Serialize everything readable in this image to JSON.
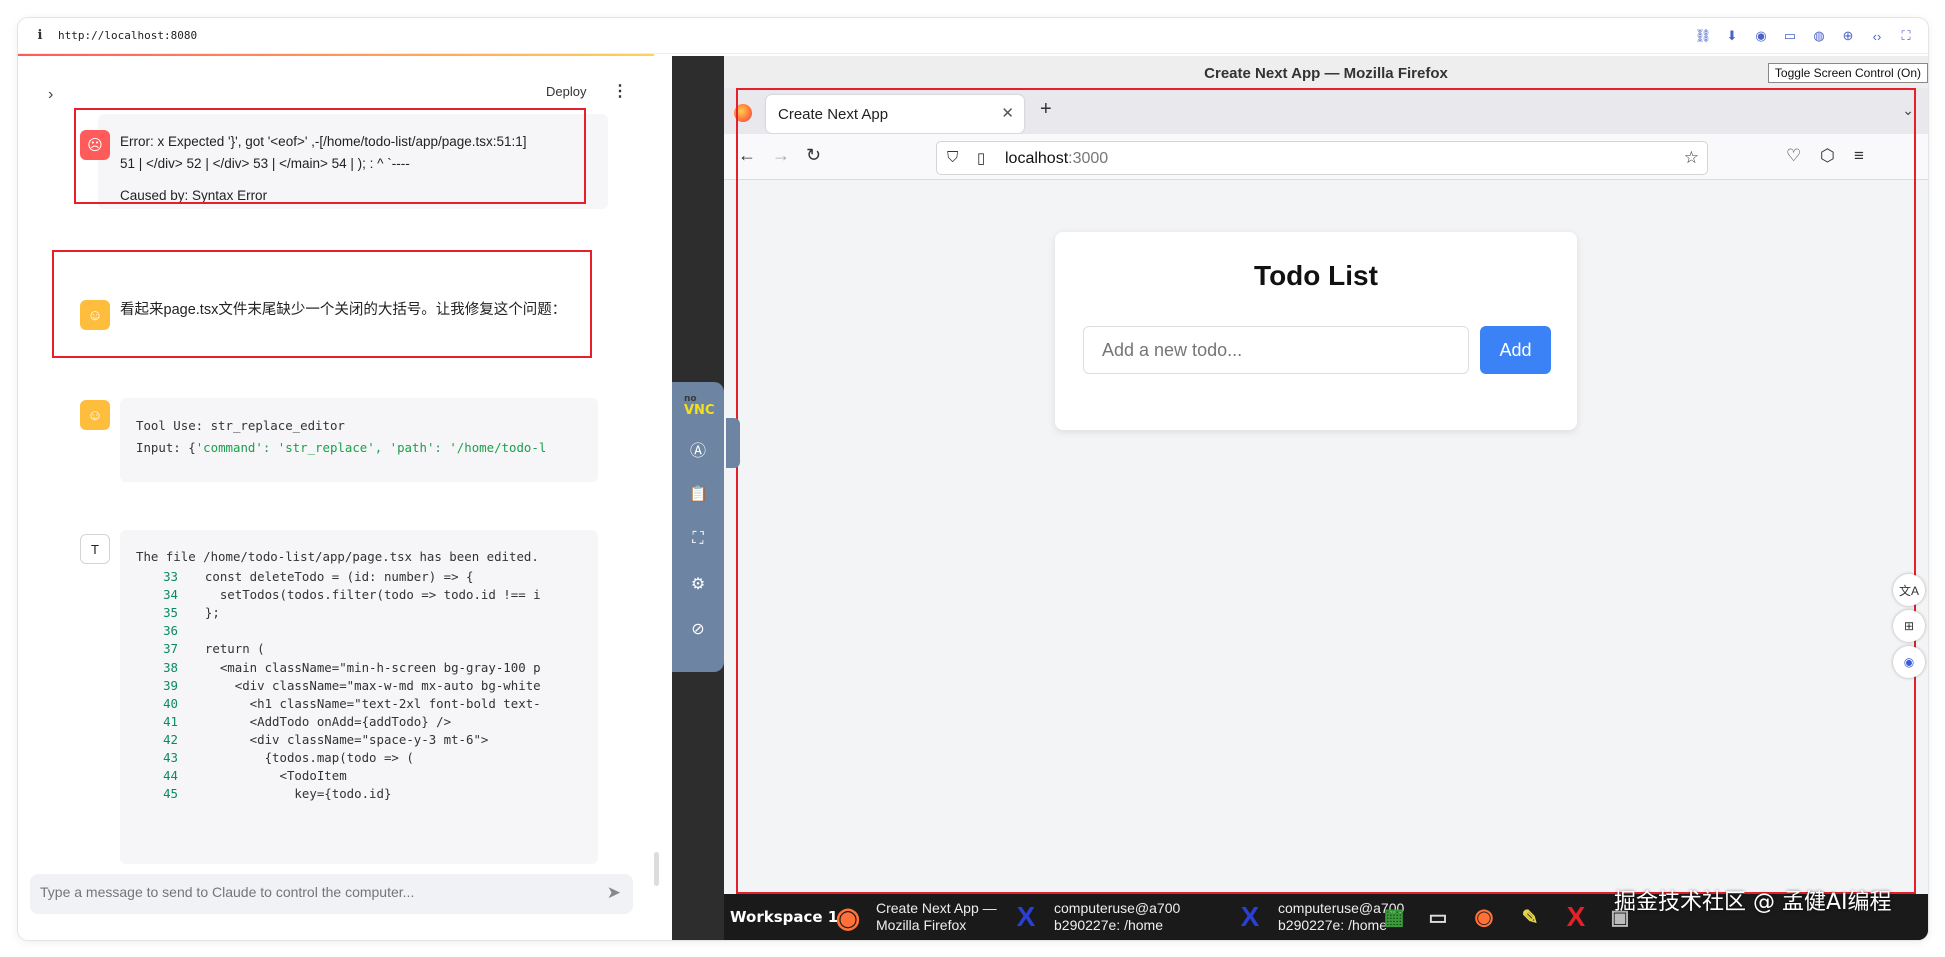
{
  "topbar": {
    "url": "http://localhost:8080"
  },
  "chat": {
    "deploy_label": "Deploy",
    "messages": {
      "error_line1": "Error: x Expected '}', got '<eof>' ,-[/home/todo-list/app/page.tsx:51:1]",
      "error_line2": "51 | </div> 52 | </div> 53 | </main> 54 | ); : ^ `----",
      "error_line3": "Caused by: Syntax Error",
      "assistant_text": "看起来page.tsx文件末尾缺少一个关闭的大括号。让我修复这个问题：",
      "tool_use": "Tool Use: str_replace_editor",
      "tool_input_prefix": "Input: {",
      "tool_input_rest": "'command': 'str_replace', 'path': '/home/todo-l",
      "tool_result_header": "The file /home/todo-list/app/page.tsx has been edited."
    },
    "code_lines": [
      {
        "n": "33",
        "code": "  const deleteTodo = (id: number) => {"
      },
      {
        "n": "34",
        "code": "    setTodos(todos.filter(todo => todo.id !== i"
      },
      {
        "n": "35",
        "code": "  };"
      },
      {
        "n": "36",
        "code": ""
      },
      {
        "n": "37",
        "code": "  return ("
      },
      {
        "n": "38",
        "code": "    <main className=\"min-h-screen bg-gray-100 p"
      },
      {
        "n": "39",
        "code": "      <div className=\"max-w-md mx-auto bg-white"
      },
      {
        "n": "40",
        "code": "        <h1 className=\"text-2xl font-bold text-"
      },
      {
        "n": "41",
        "code": "        <AddTodo onAdd={addTodo} />"
      },
      {
        "n": "42",
        "code": "        <div className=\"space-y-3 mt-6\">"
      },
      {
        "n": "43",
        "code": "          {todos.map(todo => ("
      },
      {
        "n": "44",
        "code": "            <TodoItem"
      },
      {
        "n": "45",
        "code": "              key={todo.id}"
      }
    ],
    "input_placeholder": "Type a message to send to Claude to control the computer..."
  },
  "vnc": {
    "window_title": "Create Next App — Mozilla Firefox",
    "toggle_label": "Toggle Screen Control (On)",
    "firefox": {
      "tab_title": "Create Next App",
      "url_host": "localhost",
      "url_port": ":3000"
    },
    "app": {
      "heading": "Todo List",
      "input_placeholder": "Add a new todo...",
      "add_button": "Add"
    },
    "novnc_logo_top": "no",
    "novnc_logo_bottom": "VNC",
    "taskbar": {
      "workspace": "Workspace 1",
      "firefox_task_line1": "Create Next App —",
      "firefox_task_line2": "Mozilla Firefox",
      "term1_line1": "computeruse@a700",
      "term1_line2": "b290227e: /home",
      "term2_line1": "computeruse@a700",
      "term2_line2": "b290227e: /home"
    }
  },
  "watermark": "掘金技术社区 @ 孟健AI编程",
  "colors": {
    "highlight_red": "#e5202a",
    "add_button_blue": "#3b82f6",
    "novnc_panel": "#6e84a3"
  }
}
